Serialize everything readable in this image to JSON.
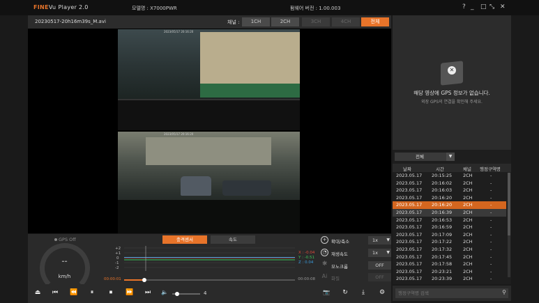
{
  "header": {
    "logo_fine": "FINE",
    "logo_vu": "Vu",
    "app_title": "Player 2.0",
    "model": "모델명 : X7000PWR",
    "firmware": "펌웨어 버전 : 1.00.003",
    "help": "?",
    "minimize": "_",
    "maximize": "□",
    "restore": "⤡",
    "close": "✕"
  },
  "file": {
    "name": "20230517-20h16m39s_M.avi",
    "channel_label": "채널 :",
    "channels": [
      "1CH",
      "2CH",
      "3CH",
      "4CH",
      "전체"
    ],
    "active_channel": "전체"
  },
  "video": {
    "frame1_stamp": "2023/05/17 20:16:20",
    "frame2_stamp": "2023/05/17 20:16:20"
  },
  "gps": {
    "message": "해당 영상에 GPS 정보가 없습니다.",
    "sub": "외장 GPS의 연결을 확인해 주세요."
  },
  "list": {
    "filter": "전체",
    "headers": [
      "날짜",
      "시간",
      "채널",
      "행정구역명"
    ],
    "rows": [
      {
        "date": "2023.05.17",
        "time": "20:15:25",
        "ch": "2CH",
        "area": "-"
      },
      {
        "date": "2023.05.17",
        "time": "20:16:02",
        "ch": "2CH",
        "area": "-"
      },
      {
        "date": "2023.05.17",
        "time": "20:16:03",
        "ch": "2CH",
        "area": "-"
      },
      {
        "date": "2023.05.17",
        "time": "20:16:20",
        "ch": "2CH",
        "area": "-"
      },
      {
        "date": "2023.05.17",
        "time": "20:16:20",
        "ch": "2CH",
        "area": "-"
      },
      {
        "date": "2023.05.17",
        "time": "20:16:39",
        "ch": "2CH",
        "area": "-"
      },
      {
        "date": "2023.05.17",
        "time": "20:16:53",
        "ch": "2CH",
        "area": "-"
      },
      {
        "date": "2023.05.17",
        "time": "20:16:59",
        "ch": "2CH",
        "area": "-"
      },
      {
        "date": "2023.05.17",
        "time": "20:17:09",
        "ch": "2CH",
        "area": "-"
      },
      {
        "date": "2023.05.17",
        "time": "20:17:22",
        "ch": "2CH",
        "area": "-"
      },
      {
        "date": "2023.05.17",
        "time": "20:17:32",
        "ch": "2CH",
        "area": "-"
      },
      {
        "date": "2023.05.17",
        "time": "20:17:45",
        "ch": "2CH",
        "area": "-"
      },
      {
        "date": "2023.05.17",
        "time": "20:17:58",
        "ch": "2CH",
        "area": "-"
      },
      {
        "date": "2023.05.17",
        "time": "20:23:21",
        "ch": "2CH",
        "area": "-"
      },
      {
        "date": "2023.05.17",
        "time": "20:23:39",
        "ch": "2CH",
        "area": "-"
      }
    ],
    "selected_index": 4,
    "hover_index": 5
  },
  "search": {
    "placeholder": "행정구역명 검색"
  },
  "speed": {
    "gps_status": "GPS Off",
    "value": "--",
    "unit": "km/h"
  },
  "sensor": {
    "tab_impact": "충격센서",
    "tab_speed": "속도",
    "yticks": [
      "+2",
      "+1",
      "0",
      "-1",
      "-2"
    ],
    "legend_x": "X : -0.04",
    "legend_y": "Y : -0.51",
    "legend_z": "Z : 0.04",
    "time_current": "00:00:01",
    "time_total": "00:00:08",
    "progress": 0.12,
    "colors": {
      "x": "#e04a3a",
      "y": "#3cc45a",
      "z": "#3a9ee0"
    }
  },
  "options": {
    "zoom_label": "확대/축소",
    "zoom_value": "1x",
    "speed_label": "재생속도",
    "speed_value": "1x",
    "mono_label": "모노크롬",
    "mono_value": "OFF",
    "ai_icon": "Ai",
    "ai_label": "화질",
    "ai_value": "OFF"
  },
  "playback": {
    "eject": "⏏",
    "prev": "⏮",
    "rewind": "⏪",
    "pause": "⏸",
    "stop": "⏹",
    "forward": "⏩",
    "next": "⏭",
    "volume_icon": "🔈",
    "volume": "4",
    "volume_level": 0.1,
    "snapshot": "📷",
    "rotate": "↻",
    "download": "⤓",
    "settings": "⚙"
  },
  "accent": "#e8742a"
}
